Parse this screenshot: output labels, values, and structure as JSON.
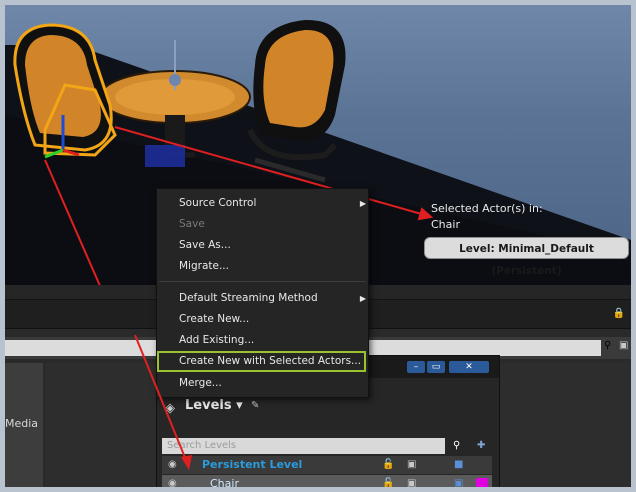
{
  "viewport": {
    "selected_actor_label": "Selected Actor(s) in:",
    "selected_actor_name": "Chair",
    "level_badge": "Level:  Minimal_Default (Persistent)"
  },
  "context_menu": {
    "items": [
      {
        "label": "Source Control",
        "submenu": true,
        "enabled": true
      },
      {
        "label": "Save",
        "submenu": false,
        "enabled": false
      },
      {
        "label": "Save As...",
        "submenu": false,
        "enabled": true
      },
      {
        "label": "Migrate...",
        "submenu": false,
        "enabled": true
      },
      {
        "label": "Default Streaming Method",
        "submenu": true,
        "enabled": true
      },
      {
        "label": "Create New...",
        "submenu": false,
        "enabled": true
      },
      {
        "label": "Add Existing...",
        "submenu": false,
        "enabled": true
      },
      {
        "label": "Create New with Selected Actors...",
        "submenu": false,
        "enabled": true,
        "highlighted": true
      },
      {
        "label": "Merge...",
        "submenu": false,
        "enabled": true
      }
    ],
    "highlight_color": "#9ac32d"
  },
  "editor": {
    "left_panel_label": "Media"
  },
  "levels_panel": {
    "title": "Levels",
    "search_placeholder": "Search Levels",
    "rows": [
      {
        "name": "Persistent Level",
        "color": "#2b9bdc"
      },
      {
        "name": "Chair",
        "color": "#cfe9ff",
        "swatch": "#e000e0"
      }
    ]
  },
  "annotation_color": "#e02020"
}
